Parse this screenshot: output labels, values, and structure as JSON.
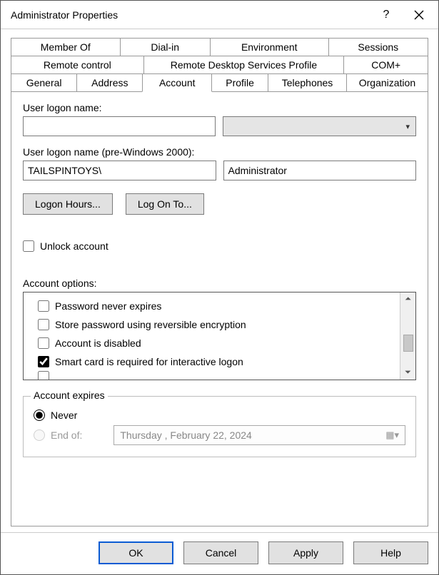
{
  "title": "Administrator Properties",
  "tabs": {
    "row1": [
      "Member Of",
      "Dial-in",
      "Environment",
      "Sessions"
    ],
    "row2": [
      "Remote control",
      "Remote Desktop Services Profile",
      "COM+"
    ],
    "row3": [
      "General",
      "Address",
      "Account",
      "Profile",
      "Telephones",
      "Organization"
    ]
  },
  "active_tab": "Account",
  "account": {
    "logon_name_label": "User logon name:",
    "logon_name_value": "",
    "logon_name_pre2000_label": "User logon name (pre-Windows 2000):",
    "domain_value": "TAILSPINTOYS\\",
    "user_value": "Administrator",
    "btn_logon_hours": "Logon Hours...",
    "btn_logon_to": "Log On To...",
    "unlock_label": "Unlock account",
    "unlock_checked": false,
    "options_label": "Account options:",
    "options": [
      {
        "label": "Password never expires",
        "checked": false
      },
      {
        "label": "Store password using reversible encryption",
        "checked": false
      },
      {
        "label": "Account is disabled",
        "checked": false
      },
      {
        "label": "Smart card is required for interactive logon",
        "checked": true
      }
    ],
    "expires": {
      "legend": "Account expires",
      "never_label": "Never",
      "endof_label": "End of:",
      "selected": "never",
      "date_text": "Thursday ,  February  22, 2024"
    }
  },
  "footer": {
    "ok": "OK",
    "cancel": "Cancel",
    "apply": "Apply",
    "help": "Help"
  }
}
